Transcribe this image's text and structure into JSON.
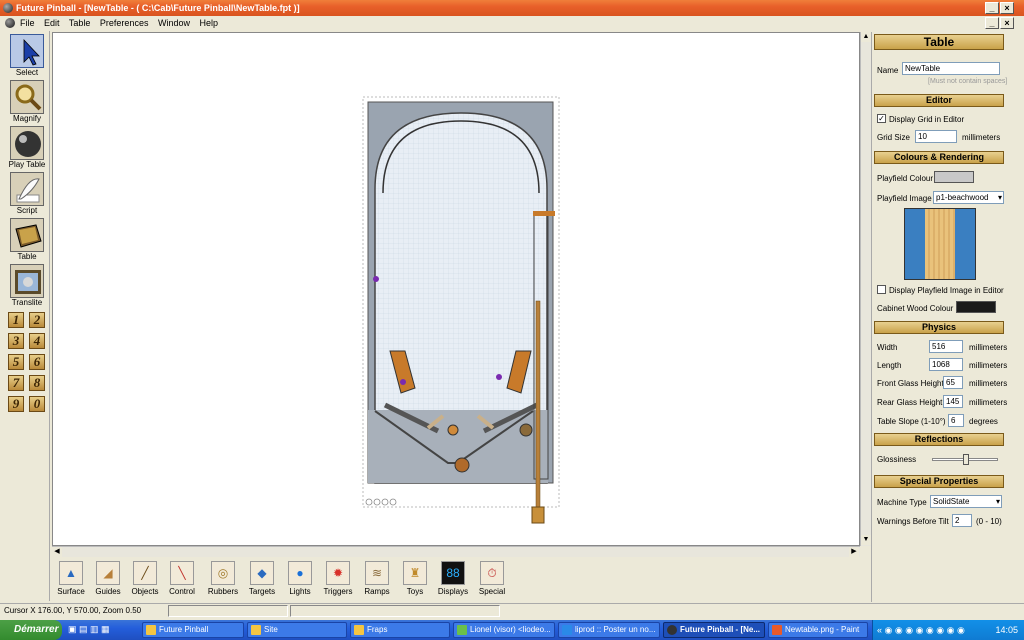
{
  "window": {
    "title": "Future Pinball - [NewTable - ( C:\\Cab\\Future Pinball\\NewTable.fpt )]"
  },
  "menu": [
    "File",
    "Edit",
    "Table",
    "Preferences",
    "Window",
    "Help"
  ],
  "tools": [
    {
      "label": "Select"
    },
    {
      "label": "Magnify"
    },
    {
      "label": "Play Table"
    },
    {
      "label": "Script"
    },
    {
      "label": "Table"
    },
    {
      "label": "Translite"
    }
  ],
  "numbers": [
    "1",
    "2",
    "3",
    "4",
    "5",
    "6",
    "7",
    "8",
    "9",
    "0"
  ],
  "objects": [
    "Surface",
    "Guides",
    "Objects",
    "Control",
    "Rubbers",
    "Targets",
    "Lights",
    "Triggers",
    "Ramps",
    "Toys",
    "Displays",
    "Special"
  ],
  "panel": {
    "title": "Table",
    "name_label": "Name",
    "name_value": "NewTable",
    "name_hint": "[Must not contain spaces]",
    "editor": {
      "header": "Editor",
      "display_grid": "Display Grid in Editor",
      "grid_size_label": "Grid Size",
      "grid_size_value": "10",
      "grid_unit": "millimeters"
    },
    "colours": {
      "header": "Colours & Rendering",
      "playfield_colour": "Playfield Colour",
      "playfield_image": "Playfield Image",
      "playfield_image_value": "p1-beachwood",
      "display_image": "Display Playfield Image in Editor",
      "cabinet_wood": "Cabinet Wood Colour"
    },
    "physics": {
      "header": "Physics",
      "rows": [
        {
          "label": "Width",
          "value": "516",
          "unit": "millimeters"
        },
        {
          "label": "Length",
          "value": "1068",
          "unit": "millimeters"
        },
        {
          "label": "Front Glass Height",
          "value": "65",
          "unit": "millimeters"
        },
        {
          "label": "Rear Glass Height",
          "value": "145",
          "unit": "millimeters"
        },
        {
          "label": "Table Slope (1-10°)",
          "value": "6",
          "unit": "degrees"
        }
      ]
    },
    "reflections": {
      "header": "Reflections",
      "glossiness": "Glossiness",
      "glossiness_level": 0.5
    },
    "special": {
      "header": "Special Properties",
      "machine_type_label": "Machine Type",
      "machine_type_value": "SolidState",
      "warnings_label": "Warnings Before Tilt",
      "warnings_value": "2",
      "warnings_range": "(0 - 10)"
    }
  },
  "status": {
    "cursor": "Cursor X 176.00, Y 570.00, Zoom 0.50"
  },
  "taskbar": {
    "start": "Démarrer",
    "tasks": [
      "Future Pinball",
      "Site",
      "Fraps",
      "Lionel (visor) <liodeo...",
      "liprod :: Poster un no...",
      "Future Pinball - [Ne...",
      "Newtable.png - Paint"
    ],
    "clock": "14:05"
  },
  "colors": {
    "titlebar": "#e8602a",
    "header_gold": "#c9a24a",
    "playfield_blue": "#3a7fc1",
    "playfield_wood": "#e9c27b",
    "cabinet": "#1a1a1a"
  }
}
